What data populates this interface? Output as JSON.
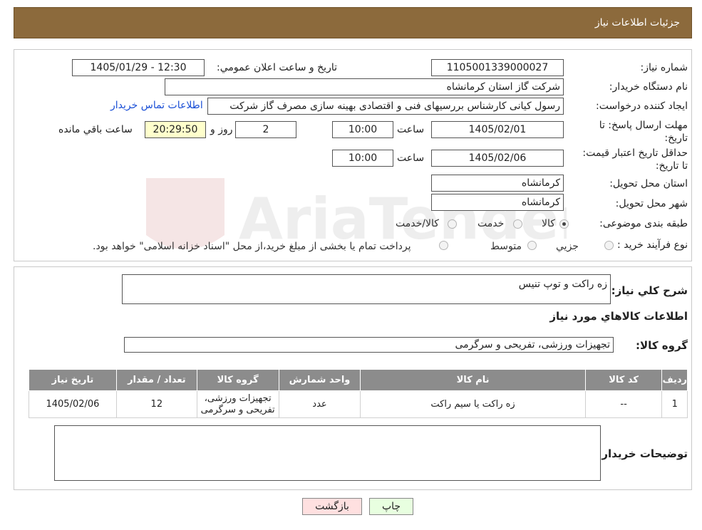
{
  "header": {
    "title": "جزئیات اطلاعات نیاز"
  },
  "form": {
    "need_number_label": "شماره نیاز:",
    "need_number": "1105001339000027",
    "announce_label": "تاریخ و ساعت اعلان عمومي:",
    "announce_value": "1405/01/29 - 12:30",
    "buyer_org_label": "نام دستگاه خريدار:",
    "buyer_org": "شرکت گاز استان کرمانشاه",
    "requester_label": "ايجاد کننده درخواست:",
    "requester": "رسول کیانی کارشناس بررسیهای فنی و اقتصادی بهینه سازی مصرف گاز شرکت",
    "contact_link": "اطلاعات تماس خريدار",
    "deadline_label": "مهلت ارسال پاسخ: تا تاريخ:",
    "deadline_date": "1405/02/01",
    "time_label": "ساعت",
    "deadline_time": "10:00",
    "days_value": "2",
    "days_label": "روز و",
    "remaining_time": "20:29:50",
    "remaining_label": "ساعت باقي مانده",
    "validity_label": "حداقل تاريخ اعتبار قيمت: تا تاريخ:",
    "validity_date": "1405/02/06",
    "validity_time": "10:00",
    "province_label": "استان محل تحويل:",
    "province": "کرمانشاه",
    "city_label": "شهر محل تحويل:",
    "city": "کرمانشاه",
    "category_label": "طبقه بندی موضوعی:",
    "category_options": [
      "کالا",
      "خدمت",
      "کالا/خدمت"
    ],
    "category_selected": 0,
    "process_label": "نوع فرآيند خريد :",
    "process_options": [
      "جزيي",
      "متوسط"
    ],
    "process_note": "پرداخت تمام یا بخشی از مبلغ خرید،از محل \"اسناد خزانه اسلامی\" خواهد بود."
  },
  "description": {
    "label": "شرح کلي نياز:",
    "value": "زه راکت و توپ تنیس"
  },
  "goods": {
    "section_title": "اطلاعات کالاهاي مورد نياز",
    "group_label": "گروه کالا:",
    "group_value": "تجهیزات ورزشی، تفریحی و سرگرمی",
    "columns": [
      "رديف",
      "کد کالا",
      "نام کالا",
      "واحد شمارش",
      "گروه کالا",
      "تعداد / مقدار",
      "تاريخ نياز"
    ],
    "rows": [
      [
        "1",
        "--",
        "زه راکت یا سیم راکت",
        "عدد",
        "تجهیزات ورزشی، تفریحی و سرگرمی",
        "12",
        "1405/02/06"
      ]
    ]
  },
  "buyer_notes": {
    "label": "توضيحات خريدار:",
    "value": ""
  },
  "buttons": {
    "print": "چاپ",
    "back": "بازگشت"
  },
  "colors": {
    "header_bg": "#8c6a3c",
    "table_header_bg": "#8c8c8c",
    "link": "#1a4fd6",
    "remaining_bg": "#ffffcc",
    "back_btn_bg": "#ffe0e0",
    "print_btn_bg": "#e8ffe0"
  }
}
